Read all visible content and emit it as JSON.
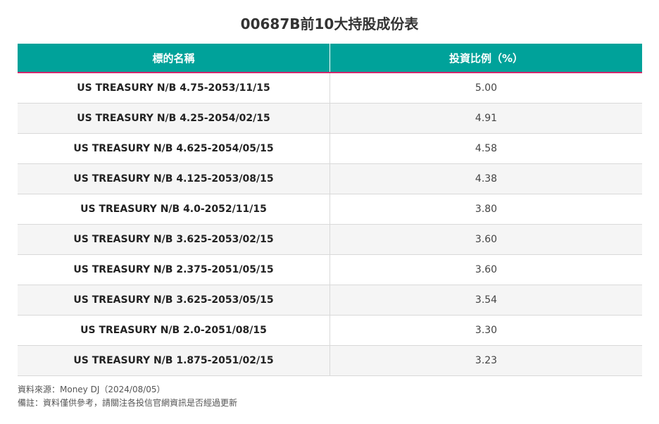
{
  "title": "00687B前10大持股成份表",
  "table": {
    "headers": {
      "name": "標的名稱",
      "weight": "投資比例（%）"
    },
    "rows": [
      {
        "name": "US TREASURY N/B 4.75-2053/11/15",
        "weight": "5.00"
      },
      {
        "name": "US TREASURY N/B 4.25-2054/02/15",
        "weight": "4.91"
      },
      {
        "name": "US TREASURY N/B 4.625-2054/05/15",
        "weight": "4.58"
      },
      {
        "name": "US TREASURY N/B 4.125-2053/08/15",
        "weight": "4.38"
      },
      {
        "name": "US TREASURY N/B 4.0-2052/11/15",
        "weight": "3.80"
      },
      {
        "name": "US TREASURY N/B 3.625-2053/02/15",
        "weight": "3.60"
      },
      {
        "name": "US TREASURY N/B 2.375-2051/05/15",
        "weight": "3.60"
      },
      {
        "name": "US TREASURY N/B 3.625-2053/05/15",
        "weight": "3.54"
      },
      {
        "name": "US TREASURY N/B 2.0-2051/08/15",
        "weight": "3.30"
      },
      {
        "name": "US TREASURY N/B 1.875-2051/02/15",
        "weight": "3.23"
      }
    ]
  },
  "notes": {
    "source": "資料來源：Money DJ（2024/08/05）",
    "remark": "備註：資料僅供參考，請關注各投信官網資訊是否經過更新"
  },
  "colors": {
    "header_bg": "#00a29a",
    "header_accent": "#d1286c"
  }
}
